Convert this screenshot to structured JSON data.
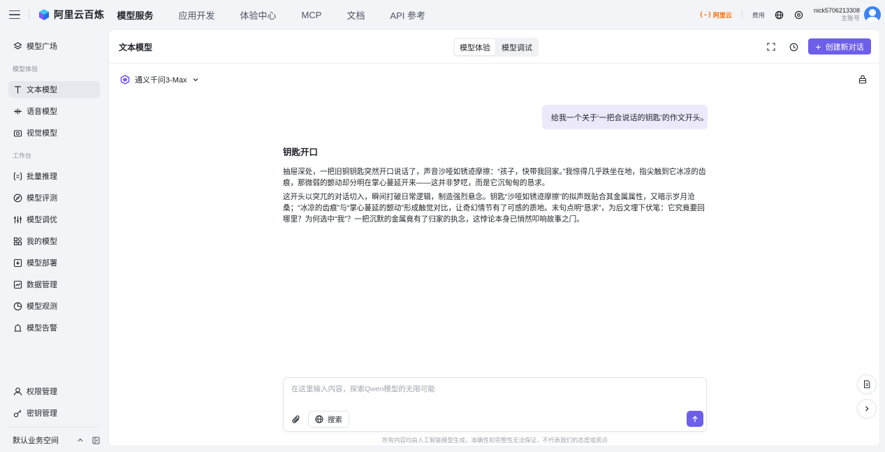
{
  "brand": {
    "name": "阿里云百炼"
  },
  "nav": {
    "items": [
      "模型服务",
      "应用开发",
      "体验中心",
      "MCP",
      "文档",
      "API 参考"
    ],
    "active": "模型服务"
  },
  "top_right": {
    "aliyun_logo": "阿里云",
    "fee": "费用",
    "icons": [
      "globe-icon",
      "settings-icon"
    ],
    "account_name": "nick5706213308",
    "account_role": "主账号"
  },
  "sidebar": {
    "plaza": {
      "label": "模型广场",
      "icon": "plaza-icon"
    },
    "group_experience": "模型体验",
    "experience_items": [
      {
        "label": "文本模型",
        "icon": "text-icon",
        "active": true
      },
      {
        "label": "语音模型",
        "icon": "voice-icon",
        "active": false
      },
      {
        "label": "视觉模型",
        "icon": "camera-icon",
        "active": false
      }
    ],
    "group_workbench": "工作台",
    "workbench_items": [
      {
        "label": "批量推理",
        "icon": "batch-icon"
      },
      {
        "label": "模型评测",
        "icon": "compass-icon"
      },
      {
        "label": "模型调优",
        "icon": "tune-icon"
      },
      {
        "label": "我的模型",
        "icon": "grid-icon"
      },
      {
        "label": "模型部署",
        "icon": "deploy-icon"
      },
      {
        "label": "数据管理",
        "icon": "chart-icon"
      },
      {
        "label": "模型观测",
        "icon": "pie-icon"
      },
      {
        "label": "模型告警",
        "icon": "alarm-icon"
      }
    ],
    "bottom_items": [
      {
        "label": "权限管理",
        "icon": "user-icon"
      },
      {
        "label": "密钥管理",
        "icon": "key-icon"
      }
    ],
    "workspace": "默认业务空间"
  },
  "main": {
    "title": "文本模型",
    "tabs": [
      "模型体验",
      "模型调试"
    ],
    "active_tab": "模型体验",
    "new_chat": "创建新对话",
    "model_name": "通义千问3-Max",
    "user_message": "给我一个关于‘一把会说话的钥匙’的作文开头。",
    "reply_title": "钥匙开口",
    "reply_paragraphs": [
      "抽屉深处，一把旧铜钥匙突然开口说话了，声音沙哑如锈迹摩擦：“孩子，快带我回家。”我惊得几乎跌坐在地，指尖触到它冰凉的齿痕，那微弱的颤动却分明在掌心蔓延开来——这并非梦呓，而是它沉甸甸的恳求。",
      "这开头以突兀的对话切入，瞬间打破日常逻辑，制造强烈悬念。钥匙“沙哑如锈迹摩擦”的拟声既贴合其金属属性，又暗示岁月沧桑；“冰凉的齿痕”与“掌心蔓延的颤动”形成触觉对比，让奇幻情节有了可感的质地。末句点明“恳求”，为后文埋下伏笔：它究竟要回哪里？为何选中“我”？一把沉默的金属竟有了归家的执念，这悖论本身已悄然叩响故事之门。"
    ],
    "input_placeholder": "在这里输入内容，探索Qwen模型的无限可能",
    "search_label": "搜索",
    "disclaimer": "所有内容均由人工智能模型生成，准确性和完整性无法保证，不代表我们的态度或观点"
  },
  "colors": {
    "accent": "#6d5fea",
    "user_bubble": "#ece9fb",
    "aliyun_orange": "#ff6a00",
    "page_bg": "#f3f4f7"
  }
}
